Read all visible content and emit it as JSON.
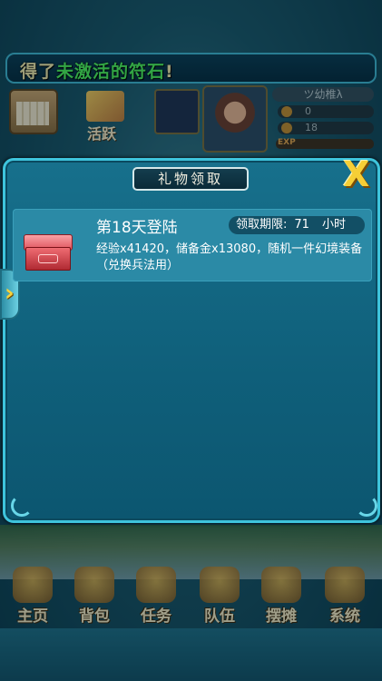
{
  "notice": {
    "part1": "得了",
    "part2": "未激活的符石",
    "part3": "!"
  },
  "hud": {
    "activity_label": "活跃",
    "player_name": "ツ幼椎λ",
    "stat1": "0",
    "stat2": "18",
    "exp_label": "EXP"
  },
  "dialog": {
    "title": "礼物领取",
    "close_symbol": "X",
    "arrow_symbol": "›",
    "gift": {
      "name": "第18天登陆",
      "deadline_label": "领取期限:",
      "deadline_value": "71",
      "deadline_unit": "小时",
      "description": "经验x41420，储备金x13080，随机一件幻境装备（兑换兵法用）"
    }
  },
  "nav": {
    "items": [
      "主页",
      "背包",
      "任务",
      "队伍",
      "摆摊",
      "系统"
    ]
  },
  "colors": {
    "accent": "#3ec4dc",
    "highlight": "#4df25a",
    "close": "#f6cf36"
  }
}
